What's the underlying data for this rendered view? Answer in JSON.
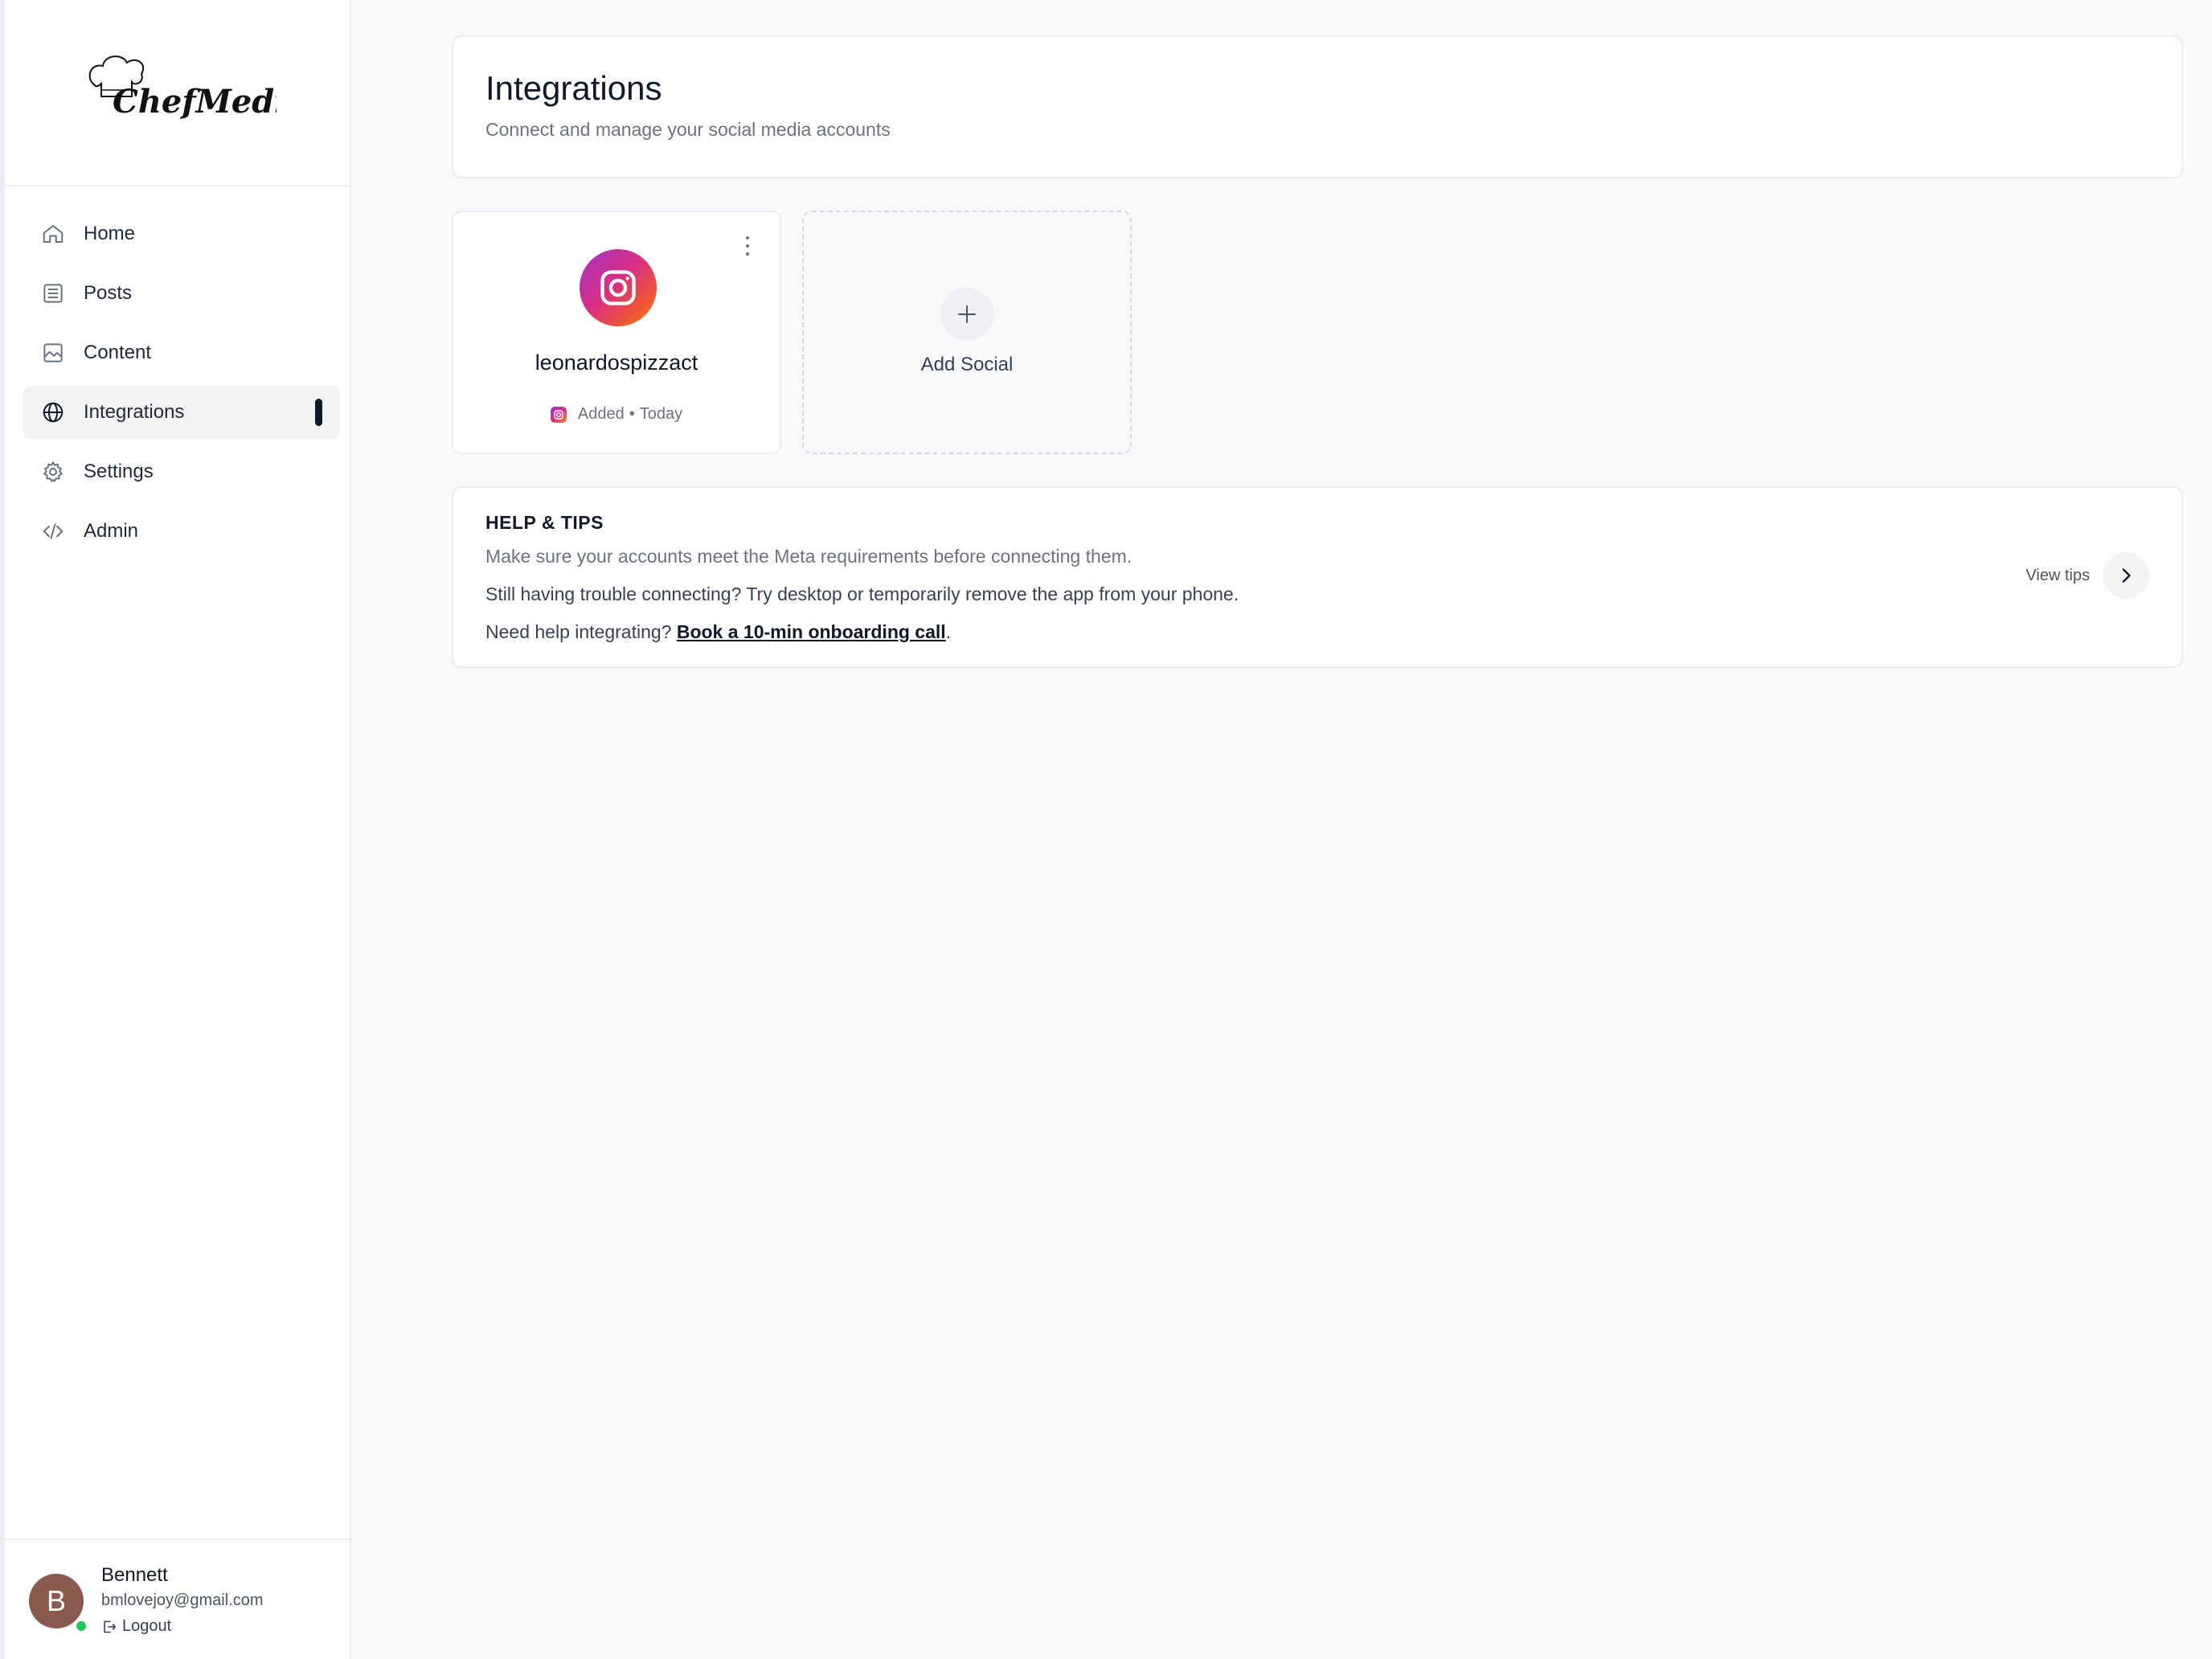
{
  "app": {
    "logo_text": "ChefMedia",
    "brand_colors": {
      "active_indicator": "#111827",
      "online": "#22c55e",
      "avatar_bg": "#8a5a4f"
    }
  },
  "sidebar": {
    "items": [
      {
        "label": "Home",
        "icon": "home-icon",
        "active": false
      },
      {
        "label": "Posts",
        "icon": "list-icon",
        "active": false
      },
      {
        "label": "Content",
        "icon": "image-icon",
        "active": false
      },
      {
        "label": "Integrations",
        "icon": "globe-icon",
        "active": true
      },
      {
        "label": "Settings",
        "icon": "gear-icon",
        "active": false
      },
      {
        "label": "Admin",
        "icon": "code-icon",
        "active": false
      }
    ]
  },
  "user": {
    "initial": "B",
    "name": "Bennett",
    "email": "bmlovejoy@gmail.com",
    "logout_label": "Logout",
    "status": "online"
  },
  "header": {
    "title": "Integrations",
    "subtitle": "Connect and manage your social media accounts"
  },
  "accounts": [
    {
      "platform": "instagram",
      "username": "leonardospizzact",
      "added_label": "Added",
      "added_when": "Today"
    }
  ],
  "add_social": {
    "label": "Add Social"
  },
  "help": {
    "title": "HELP & TIPS",
    "line1": "Make sure your accounts meet the Meta requirements before connecting them.",
    "line2": "Still having trouble connecting? Try desktop or temporarily remove the app from your phone.",
    "line3_prefix": "Need help integrating? ",
    "line3_link": "Book a 10-min onboarding call",
    "line3_suffix": ".",
    "view_tips_label": "View tips"
  }
}
